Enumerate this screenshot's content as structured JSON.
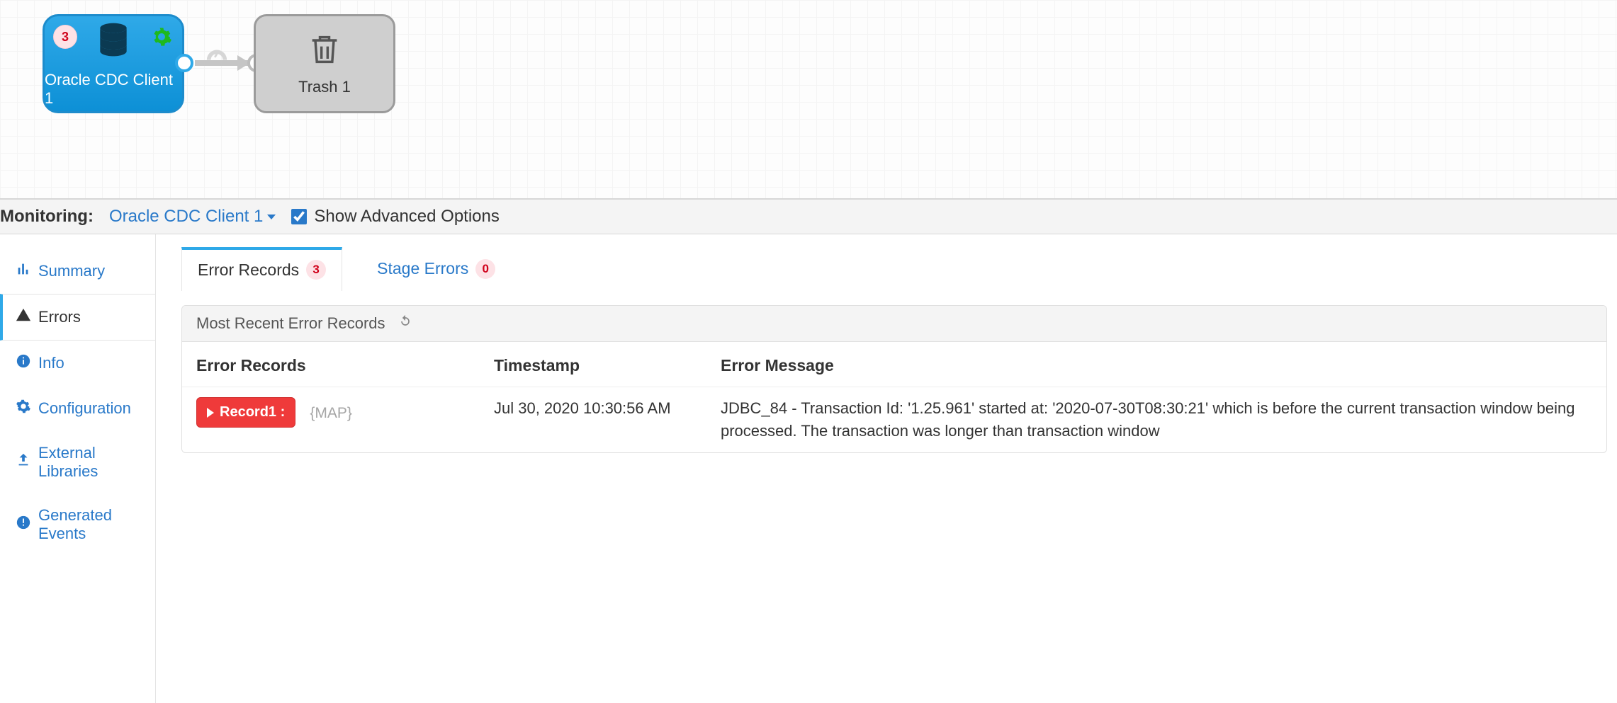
{
  "canvas": {
    "origin": {
      "label": "Oracle CDC Client 1",
      "badge": "3"
    },
    "destination": {
      "label": "Trash 1"
    }
  },
  "monitoring": {
    "label": "Monitoring:",
    "link": "Oracle CDC Client 1",
    "checkbox_label": "Show Advanced Options",
    "checkbox_checked": true
  },
  "sidebar": {
    "items": [
      {
        "label": "Summary"
      },
      {
        "label": "Errors"
      },
      {
        "label": "Info"
      },
      {
        "label": "Configuration"
      },
      {
        "label": "External Libraries"
      },
      {
        "label": "Generated Events"
      }
    ]
  },
  "tabs": {
    "error_records": {
      "label": "Error Records",
      "count": "3"
    },
    "stage_errors": {
      "label": "Stage Errors",
      "count": "0"
    }
  },
  "panel": {
    "title": "Most Recent Error Records",
    "columns": {
      "records": "Error Records",
      "timestamp": "Timestamp",
      "message": "Error Message"
    },
    "rows": [
      {
        "record_label": "Record1 :",
        "type_tag": "{MAP}",
        "timestamp": "Jul 30, 2020 10:30:56 AM",
        "message": "JDBC_84 - Transaction Id: '1.25.961' started at: '2020-07-30T08:30:21' which is before the current transaction window being processed. The transaction was longer than transaction window"
      }
    ]
  }
}
